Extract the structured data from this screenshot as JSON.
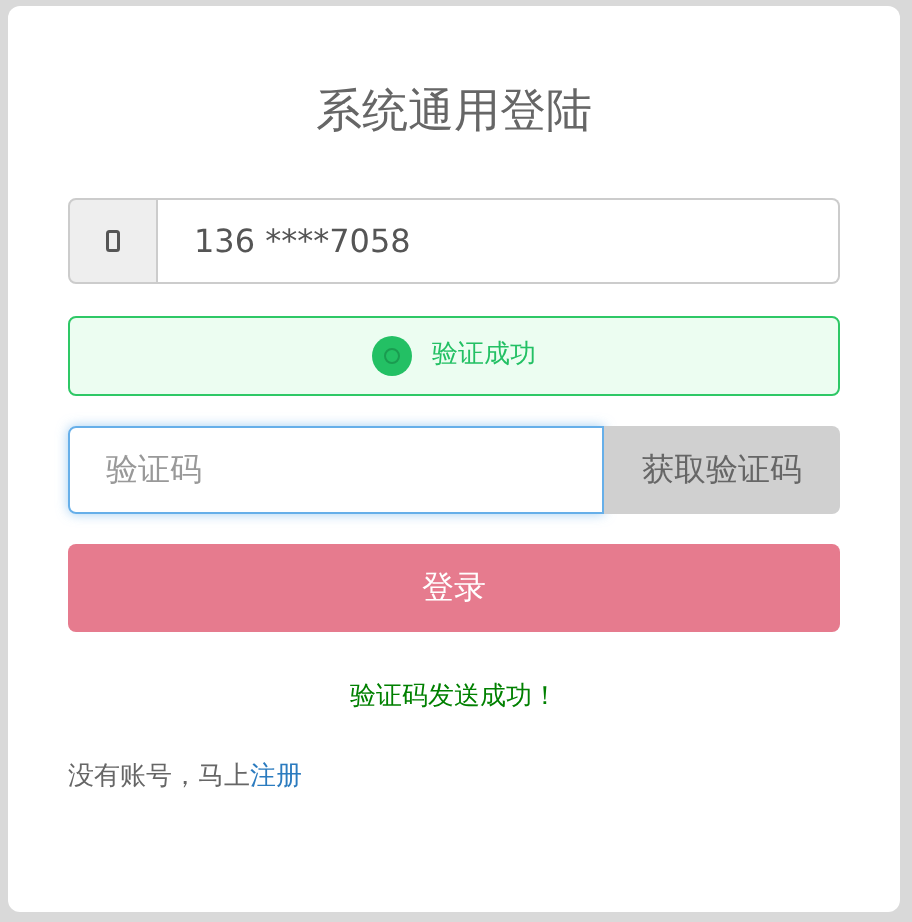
{
  "title": "系统通用登陆",
  "phone": {
    "value": "136 ****7058"
  },
  "captcha": {
    "verified": true,
    "label": "验证成功"
  },
  "code": {
    "placeholder": "验证码",
    "button": "获取验证码",
    "focused": true
  },
  "login_button": "登录",
  "message": "验证码发送成功！",
  "register": {
    "text": "没有账号，马上",
    "link": "注册"
  }
}
